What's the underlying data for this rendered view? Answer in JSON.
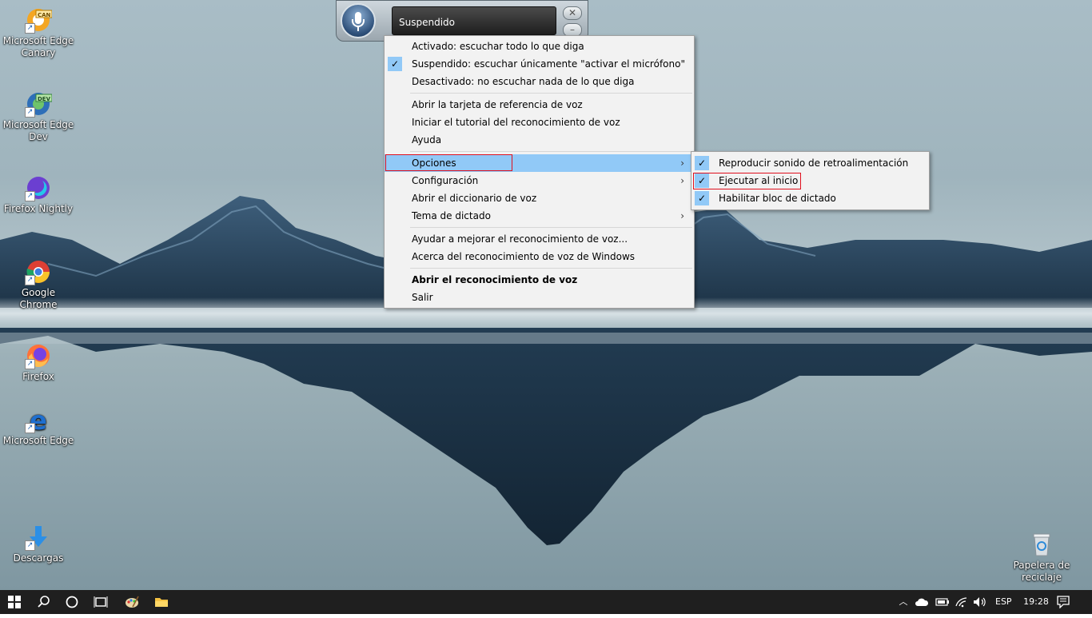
{
  "desktop_icons": [
    {
      "label": "Microsoft Edge Canary",
      "badge": "CAN",
      "icon": "edge-canary-icon",
      "color": "#f4a623"
    },
    {
      "label": "Microsoft Edge Dev",
      "badge": "DEV",
      "icon": "edge-dev-icon",
      "color": "#2f7f3a"
    },
    {
      "label": "Firefox Nightly",
      "icon": "firefox-nightly-icon",
      "color": "#6b3fd1"
    },
    {
      "label": "Google Chrome",
      "icon": "chrome-icon",
      "color": "#dd3f35"
    },
    {
      "label": "Firefox",
      "icon": "firefox-icon",
      "color": "#ff7139"
    },
    {
      "label": "Microsoft Edge",
      "icon": "edge-legacy-icon",
      "color": "#1e6fd0"
    },
    {
      "label": "Descargas",
      "icon": "downloads-icon",
      "color": "#2b8fe6"
    },
    {
      "label": "Papelera de reciclaje",
      "icon": "recycle-bin-icon",
      "color": "#d9dee2"
    }
  ],
  "speech_bar": {
    "status": "Suspendido",
    "close_glyph": "✕",
    "minimize_glyph": "–"
  },
  "context_menu": {
    "groups": [
      [
        {
          "label": "Activado: escuchar todo lo que diga",
          "checked": false
        },
        {
          "label": "Suspendido: escuchar únicamente \"activar el micrófono\"",
          "checked": true
        },
        {
          "label": "Desactivado: no escuchar nada de lo que diga",
          "checked": false
        }
      ],
      [
        {
          "label": "Abrir la tarjeta de referencia de voz"
        },
        {
          "label": "Iniciar el tutorial del reconocimiento de voz"
        },
        {
          "label": "Ayuda"
        }
      ],
      [
        {
          "label": "Opciones",
          "submenu": true,
          "highlighted": true
        },
        {
          "label": "Configuración",
          "submenu": true
        },
        {
          "label": "Abrir el diccionario de voz"
        },
        {
          "label": "Tema de dictado",
          "submenu": true
        }
      ],
      [
        {
          "label": "Ayudar a mejorar el reconocimiento de voz..."
        },
        {
          "label": "Acerca del reconocimiento de voz de Windows"
        }
      ],
      [
        {
          "label": "Abrir el reconocimiento de voz",
          "bold": true
        },
        {
          "label": "Salir"
        }
      ]
    ],
    "check_glyph": "✓",
    "submenu_glyph": "›"
  },
  "options_submenu": [
    {
      "label": "Reproducir sonido de retroalimentación",
      "checked": true
    },
    {
      "label": "Ejecutar al inicio",
      "checked": true
    },
    {
      "label": "Habilitar bloc de dictado",
      "checked": true
    }
  ],
  "taskbar": {
    "buttons": [
      "windows-start-icon",
      "search-icon",
      "cortana-icon",
      "task-view-icon",
      "paint-icon",
      "file-explorer-icon"
    ],
    "tray": {
      "language": "ESP",
      "time": "19:28"
    }
  },
  "colors": {
    "menu_highlight": "#91c9f7",
    "annotation_red": "#e0101e",
    "taskbar": "#1f1f1f"
  }
}
